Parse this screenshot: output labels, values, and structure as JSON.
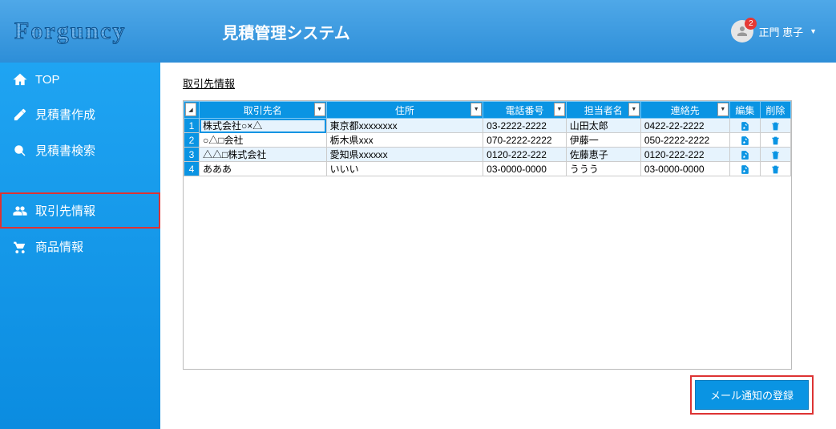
{
  "header": {
    "logo": "Forguncy",
    "title": "見積管理システム",
    "user_name": "正門 恵子",
    "badge": "2"
  },
  "sidebar": {
    "items": [
      {
        "label": "TOP",
        "icon": "home"
      },
      {
        "label": "見積書作成",
        "icon": "pencil"
      },
      {
        "label": "見積書検索",
        "icon": "search"
      },
      {
        "label": "取引先情報",
        "icon": "users"
      },
      {
        "label": "商品情報",
        "icon": "cart"
      }
    ]
  },
  "main": {
    "section_title": "取引先情報",
    "columns": [
      "取引先名",
      "住所",
      "電話番号",
      "担当者名",
      "連絡先",
      "編集",
      "削除"
    ],
    "rows": [
      {
        "n": "1",
        "name": "株式会社○×△",
        "addr": "東京都xxxxxxxx",
        "tel": "03-2222-2222",
        "person": "山田太郎",
        "contact": "0422-22-2222"
      },
      {
        "n": "2",
        "name": "○△□会社",
        "addr": "栃木県xxx",
        "tel": "070-2222-2222",
        "person": "伊藤一",
        "contact": "050-2222-2222"
      },
      {
        "n": "3",
        "name": "△△□株式会社",
        "addr": "愛知県xxxxxx",
        "tel": "0120-222-222",
        "person": "佐藤恵子",
        "contact": "0120-222-222"
      },
      {
        "n": "4",
        "name": "あああ",
        "addr": "いいい",
        "tel": "03-0000-0000",
        "person": "ううう",
        "contact": "03-0000-0000"
      }
    ],
    "button_label": "メール通知の登録"
  }
}
